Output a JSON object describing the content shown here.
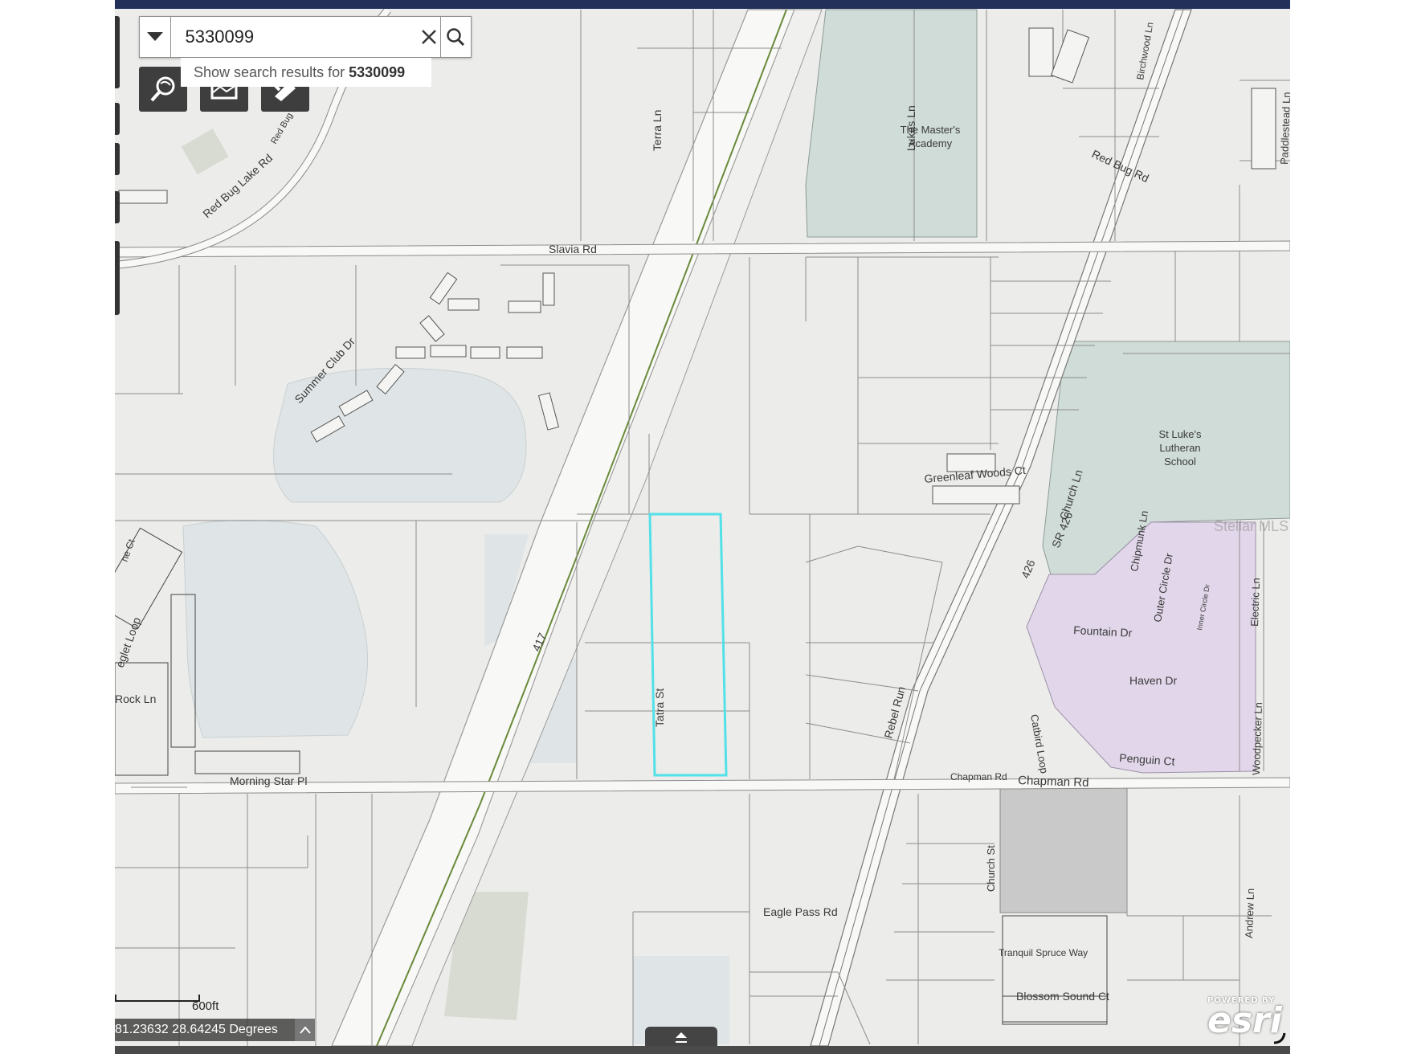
{
  "search": {
    "value": "5330099",
    "suggestion_prefix": "Show search results for",
    "suggestion_term": "5330099"
  },
  "tools": {
    "icons": [
      "identify-search-icon",
      "basemap-icon",
      "measure-tools-icon"
    ]
  },
  "map": {
    "roads": {
      "slavia": "Slavia Rd",
      "red_bug_lake": "Red Bug Lake Rd",
      "red_bug_lake_2": "Red Bug Lak",
      "red_bug_ne": "Red Bug Rd",
      "summer_club": "Summer Club Dr",
      "terra": "Terra Ln",
      "lukas": "Lukas Ln",
      "tatra": "Tatra St",
      "rebel_run": "Rebel Run",
      "morning_star": "Morning Star Pl",
      "chapman": "Chapman Rd",
      "chapman_2": "Chapman Rd",
      "eagle_pass": "Eagle Pass Rd",
      "church_st": "Church St",
      "church_ln": "Church Ln",
      "greenleaf": "Greenleaf Woods Ct",
      "sr426": "SR 426",
      "hwy426": "426",
      "hwy417": "417",
      "chipmunk": "Chipmunk Ln",
      "outer_circle": "Outer Circle Dr",
      "inner_circle": "Inner Circle Dr",
      "fountain": "Fountain Dr",
      "haven": "Haven Dr",
      "penguin": "Penguin Ct",
      "electric": "Electric Ln",
      "woodpecker": "Woodpecker Ln",
      "catbird": "Catbird Loop",
      "tranquil": "Tranquil Spruce Way",
      "blossom": "Blossom Sound Ct",
      "andrew": "Andrew Ln",
      "paddlestead": "Paddlestead Ln",
      "birchwood": "Birchwood Ln",
      "rock": "Rock Ln",
      "eglet": "eglet Loop",
      "pine_ct": "ne Ct"
    },
    "places": {
      "masters_academy_1": "The Master's",
      "masters_academy_2": "Academy",
      "st_lukes_1": "St Luke's",
      "st_lukes_2": "Lutheran",
      "st_lukes_3": "School"
    },
    "highlighted_parcel_color": "#52e1e8",
    "school_fill_color": "#cfdcd8",
    "residential_fill_color": "#e2d7ea",
    "water_fill_color": "#dfe5e6",
    "road_fill_color": "#f8f8f6",
    "parcel_fill_color": "#ececea"
  },
  "watermark": "Stellar MLS",
  "scale": {
    "label": "600ft"
  },
  "coordinates": {
    "text": "81.23632 28.64245 Degrees"
  },
  "esri": {
    "powered": "POWERED BY",
    "name": "esri"
  }
}
